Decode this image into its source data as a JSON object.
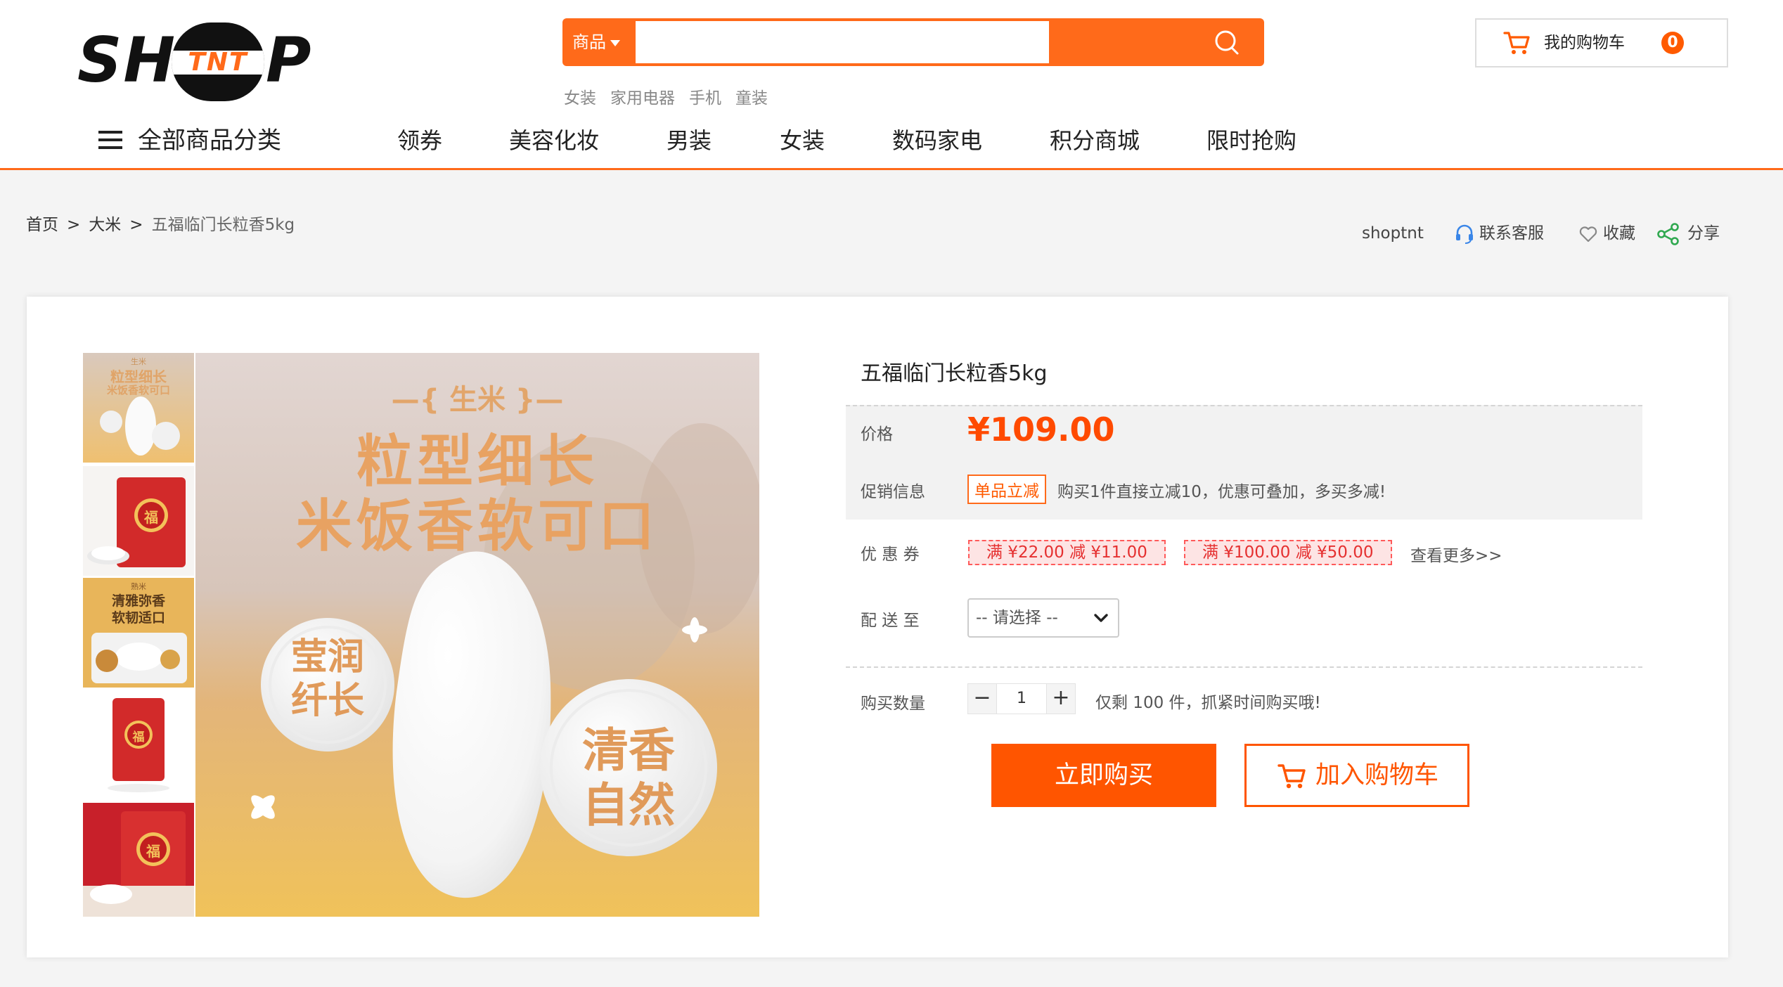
{
  "header": {
    "logo": {
      "left": "SH",
      "middle": "TNT",
      "right": "P"
    },
    "search": {
      "category": "商品",
      "placeholder": ""
    },
    "hotwords": [
      "女装",
      "家用电器",
      "手机",
      "童装"
    ],
    "cart": {
      "label": "我的购物车",
      "count": "0"
    }
  },
  "nav": {
    "all_categories": "全部商品分类",
    "items": [
      "领券",
      "美容化妆",
      "男装",
      "女装",
      "数码家电",
      "积分商城",
      "限时抢购"
    ]
  },
  "breadcrumb": {
    "items": [
      "首页",
      "大米",
      "五福临门长粒香5kg"
    ],
    "separator": ">"
  },
  "tools": {
    "shop": "shoptnt",
    "service": "联系客服",
    "favorite": "收藏",
    "share": "分享"
  },
  "product": {
    "title": "五福临门长粒香5kg",
    "price_label": "价格",
    "price": "¥109.00",
    "promo_label": "促销信息",
    "promo_tag": "单品立减",
    "promo_text": "购买1件直接立减10，优惠可叠加，多买多减!",
    "coupon_label": "优 惠 券",
    "coupons": [
      "满 ¥22.00 减 ¥11.00",
      "满 ¥100.00 减 ¥50.00"
    ],
    "more": "查看更多>>",
    "delivery_label": "配 送 至",
    "delivery_select": "-- 请选择 --",
    "qty_label": "购买数量",
    "qty_minus": "−",
    "qty": "1",
    "qty_plus": "+",
    "stock_text": "仅剩 100 件，抓紧时间购买哦!",
    "buy_now": "立即购买",
    "add_to_cart": "加入购物车"
  },
  "main_image": {
    "tag": "—{ 生米 }—",
    "headline1": "粒型细长",
    "headline2": "米饭香软可口",
    "circle1_line1": "莹润",
    "circle1_line2": "纤长",
    "circle2_line1": "清香",
    "circle2_line2": "自然"
  },
  "thumbnails": [
    {
      "lines": [
        "生米",
        "粒型细长",
        "米饭香软可口"
      ]
    },
    {
      "lines": [
        "福"
      ]
    },
    {
      "lines": [
        "熟米",
        "清雅弥香",
        "软韧适口"
      ]
    },
    {
      "lines": [
        "福"
      ]
    },
    {
      "lines": [
        "福"
      ]
    }
  ],
  "colors": {
    "accent": "#ff6a1a",
    "price": "#ff4a00",
    "coupon_bg": "#fde4e4",
    "coupon_text": "#e53030"
  }
}
